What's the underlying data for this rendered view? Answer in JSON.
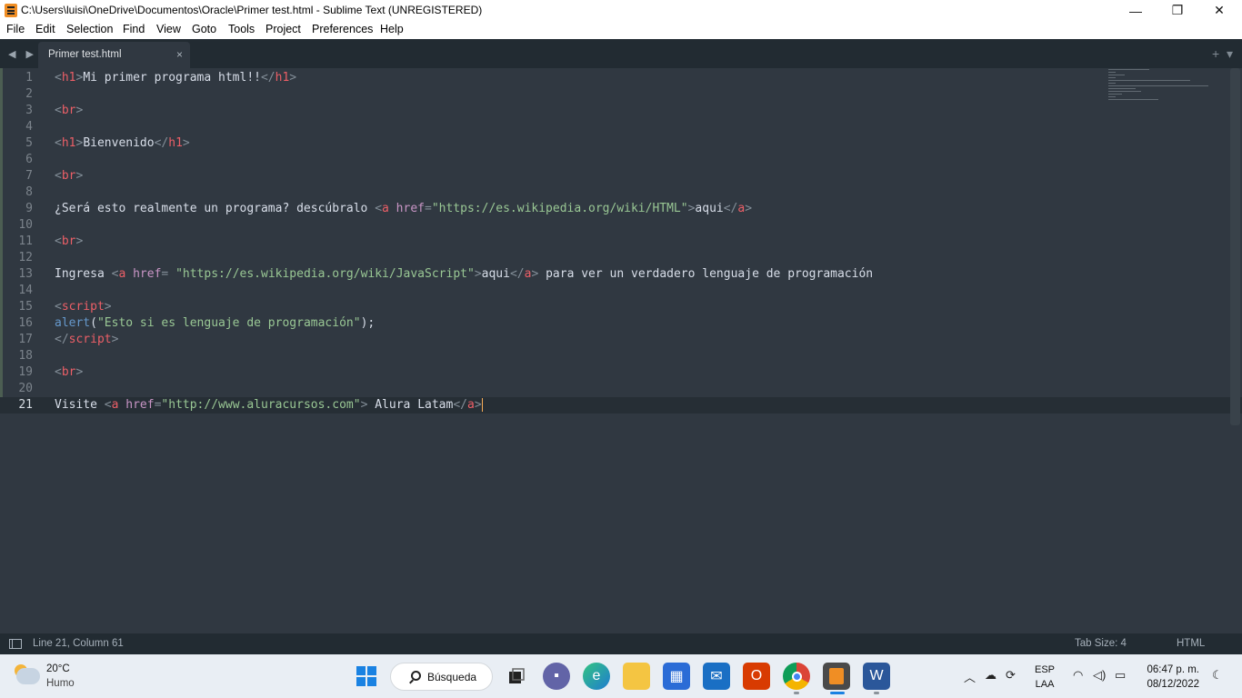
{
  "window": {
    "title": "C:\\Users\\luisi\\OneDrive\\Documentos\\Oracle\\Primer test.html - Sublime Text (UNREGISTERED)",
    "minimize": "—",
    "restore": "❐",
    "close": "✕"
  },
  "menu": [
    "File",
    "Edit",
    "Selection",
    "Find",
    "View",
    "Goto",
    "Tools",
    "Project",
    "Preferences",
    "Help"
  ],
  "tabs": {
    "nav": "◀ ▶",
    "active": {
      "label": "Primer test.html",
      "close": "×"
    },
    "new_tab": "+",
    "dropdown": "▾"
  },
  "editor": {
    "lines": [
      {
        "n": "1"
      },
      {
        "n": "2"
      },
      {
        "n": "3"
      },
      {
        "n": "4"
      },
      {
        "n": "5"
      },
      {
        "n": "6"
      },
      {
        "n": "7"
      },
      {
        "n": "8"
      },
      {
        "n": "9"
      },
      {
        "n": "10"
      },
      {
        "n": "11"
      },
      {
        "n": "12"
      },
      {
        "n": "13"
      },
      {
        "n": "14"
      },
      {
        "n": "15"
      },
      {
        "n": "16"
      },
      {
        "n": "17"
      },
      {
        "n": "18"
      },
      {
        "n": "19"
      },
      {
        "n": "20"
      },
      {
        "n": "21"
      }
    ],
    "code": {
      "l1": {
        "o": "<",
        "tag": "h1",
        "c": ">",
        "text": "Mi primer programa html!!",
        "oc": "</",
        "ctag": "h1",
        "cc": ">"
      },
      "l3": {
        "o": "<",
        "tag": "br",
        "c": ">"
      },
      "l5": {
        "o": "<",
        "tag": "h1",
        "c": ">",
        "text": "Bienvenido",
        "oc": "</",
        "ctag": "h1",
        "cc": ">"
      },
      "l7": {
        "o": "<",
        "tag": "br",
        "c": ">"
      },
      "l9": {
        "pre": "¿Será esto realmente un programa? descúbralo ",
        "o": "<",
        "tag": "a",
        "attr": " href",
        "eq": "=",
        "val": "\"https://es.wikipedia.org/wiki/HTML\"",
        "c": ">",
        "text": "aqui",
        "oc": "</",
        "ctag": "a",
        "cc": ">"
      },
      "l11": {
        "o": "<",
        "tag": "br",
        "c": ">"
      },
      "l13": {
        "pre": "Ingresa ",
        "o": "<",
        "tag": "a",
        "attr": " href",
        "eq": "= ",
        "val": "\"https://es.wikipedia.org/wiki/JavaScript\"",
        "c": ">",
        "text": "aqui",
        "oc": "</",
        "ctag": "a",
        "cc": ">",
        "post": " para ver un verdadero lenguaje de programación"
      },
      "l15": {
        "o": "<",
        "tag": "script",
        "c": ">"
      },
      "l16": {
        "fn": "alert",
        "open": "(",
        "str": "\"Esto si es lenguaje de programación\"",
        "close": ");"
      },
      "l17": {
        "o": "</",
        "tag": "script",
        "c": ">"
      },
      "l19": {
        "o": "<",
        "tag": "br",
        "c": ">"
      },
      "l21": {
        "pre": "Visite ",
        "o": "<",
        "tag": "a",
        "attr": " href",
        "eq": "=",
        "val": "\"http://www.aluracursos.com\"",
        "c": ">",
        "text": " Alura Latam",
        "oc": "</",
        "ctag": "a",
        "cc": ">"
      }
    }
  },
  "status": {
    "position": "Line 21, Column 61",
    "tab_size": "Tab Size: 4",
    "syntax": "HTML"
  },
  "taskbar": {
    "weather": {
      "temp": "20°C",
      "condition": "Humo"
    },
    "search_label": "Búsqueda",
    "apps": [
      "start-icon",
      "task-view-icon",
      "teams-chat-icon",
      "edge-icon",
      "file-explorer-icon",
      "store-icon",
      "mail-icon",
      "office-icon",
      "chrome-icon",
      "sublime-text-icon",
      "word-icon"
    ],
    "language": {
      "code": "ESP",
      "layout": "LAA"
    },
    "time": "06:47 p. m.",
    "date": "08/12/2022"
  },
  "colors": {
    "editor_bg": "#303841",
    "tag": "#ec5f67",
    "attribute": "#c895c5",
    "string": "#99c794",
    "function": "#6699cc",
    "punctuation": "#838e98",
    "cursor": "#f9ae58"
  }
}
